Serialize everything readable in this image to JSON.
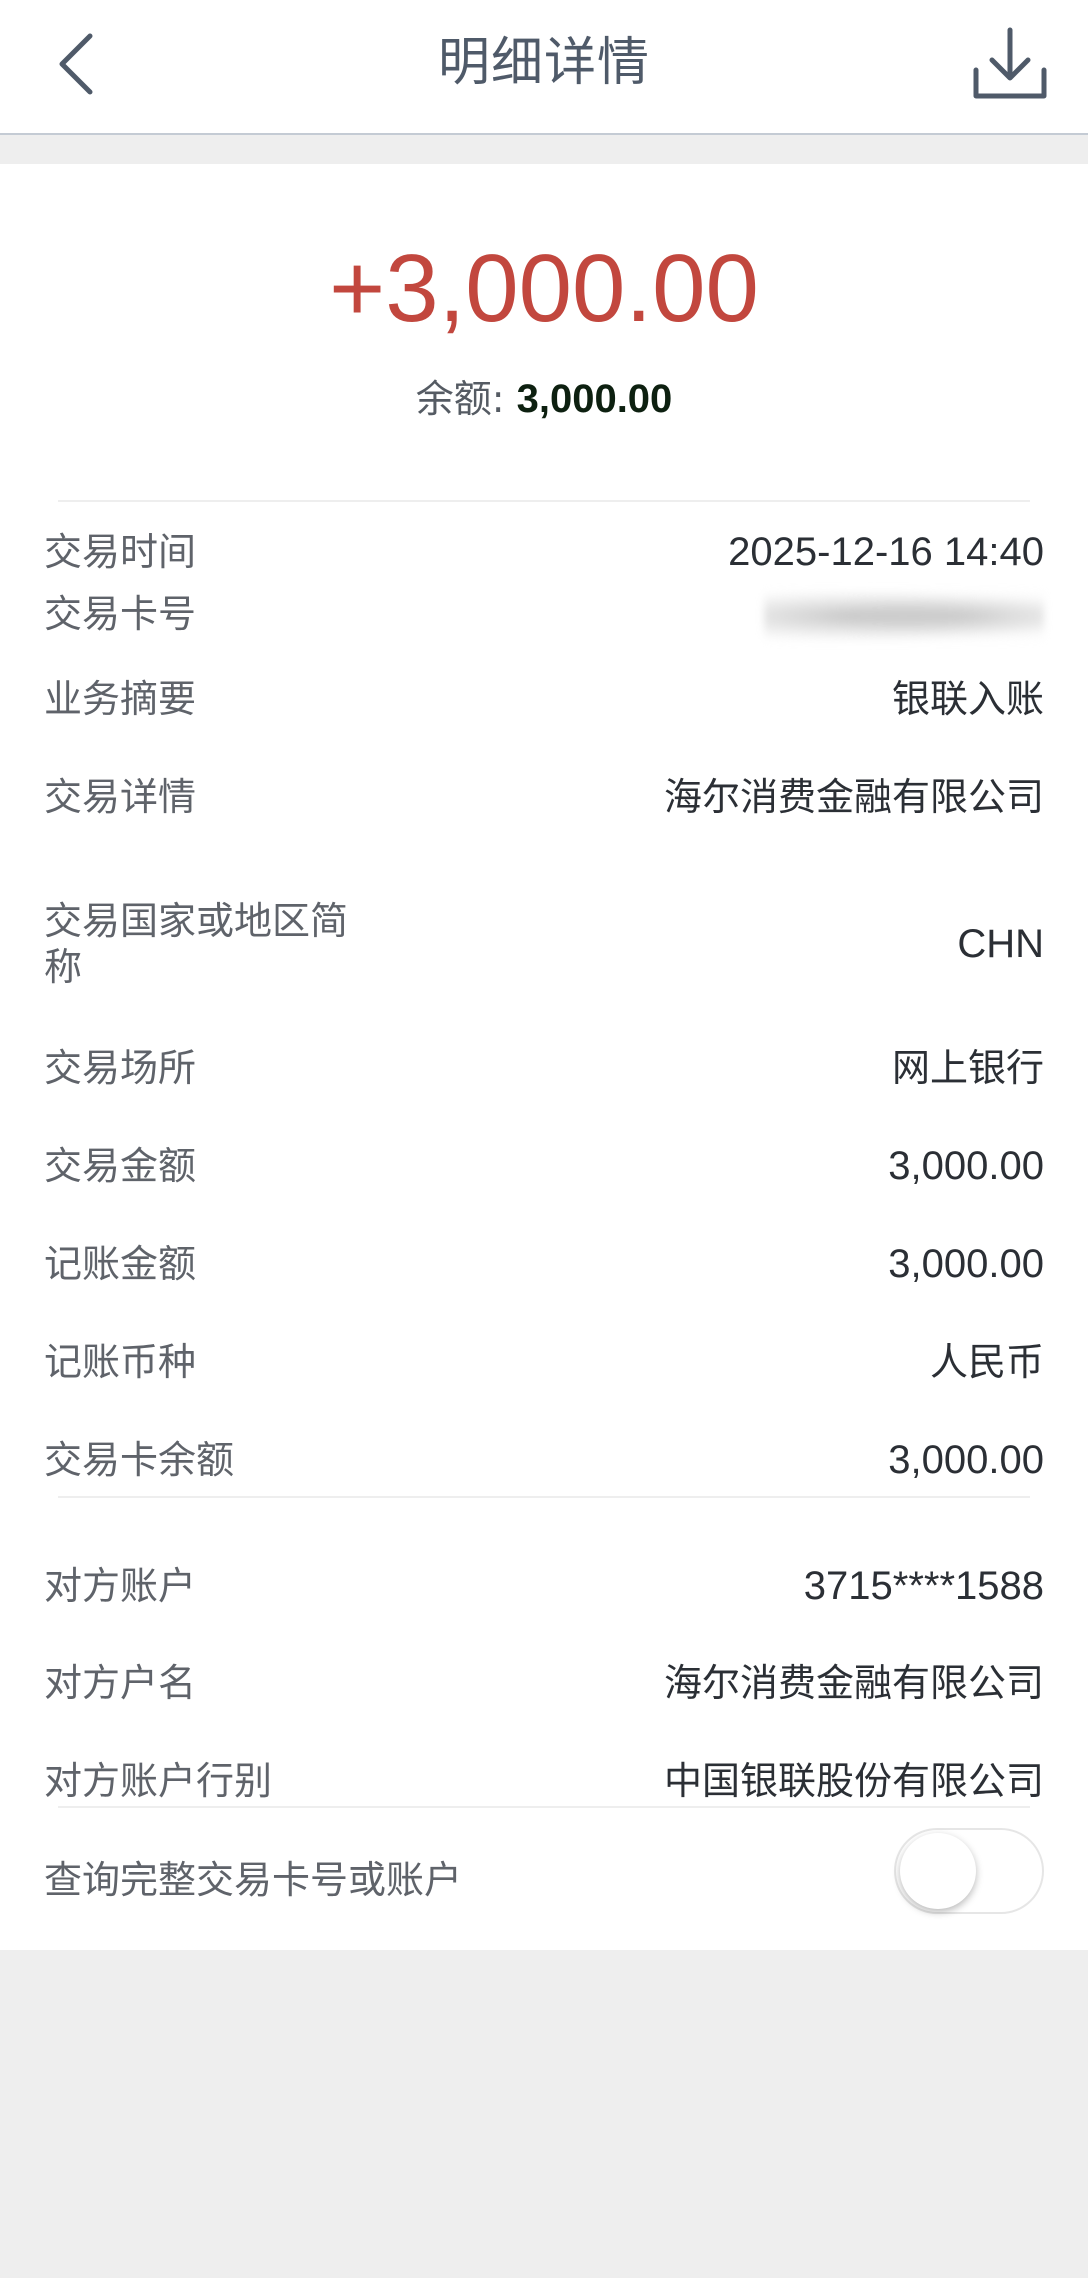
{
  "header": {
    "title": "明细详情",
    "back_icon": "chevron-left-icon",
    "download_icon": "download-icon"
  },
  "summary": {
    "amount": "+3,000.00",
    "balance_label": "余额: ",
    "balance_value": "3,000.00",
    "amount_color": "#c2473e"
  },
  "details": [
    {
      "label": "交易时间",
      "value": "2025-12-16 14:40"
    },
    {
      "label": "交易卡号",
      "value": ""
    },
    {
      "label": "业务摘要",
      "value": "银联入账"
    },
    {
      "label": "交易详情",
      "value": "海尔消费金融有限公司"
    },
    {
      "label": "交易国家或地区简称",
      "value": "CHN"
    },
    {
      "label": "交易场所",
      "value": "网上银行"
    },
    {
      "label": "交易金额",
      "value": "3,000.00"
    },
    {
      "label": "记账金额",
      "value": "3,000.00"
    },
    {
      "label": "记账币种",
      "value": "人民币"
    },
    {
      "label": "交易卡余额",
      "value": "3,000.00"
    }
  ],
  "counterparty": [
    {
      "label": "对方账户",
      "value": "3715****1588"
    },
    {
      "label": "对方户名",
      "value": "海尔消费金融有限公司"
    },
    {
      "label": "对方账户行别",
      "value": "中国银联股份有限公司"
    }
  ],
  "full_card_toggle": {
    "label": "查询完整交易卡号或账户",
    "enabled": false
  }
}
